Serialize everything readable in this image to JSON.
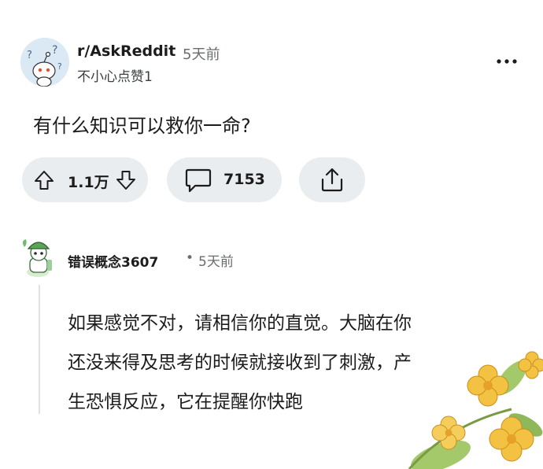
{
  "post": {
    "subreddit": "r/AskReddit",
    "time": "5天前",
    "flair": "不小心点赞1",
    "title": "有什么知识可以救你一命?"
  },
  "actions": {
    "vote_count": "1.1万",
    "comment_count": "7153"
  },
  "comment": {
    "author": "错误概念3607",
    "separator": "•",
    "time": "5天前",
    "lines": [
      "如果感觉不对，请相信你的直觉。大脑在你",
      "还没来得及思考的时候就接收到了刺激，产",
      "生恐惧反应，它在提醒你快跑"
    ]
  },
  "colors": {
    "pill_background": "#eaedef",
    "muted_text": "#6a6d70",
    "flower_yellow": "#f3c242",
    "leaf_green": "#a4c96b"
  },
  "icons": [
    "snoo-avatar-icon",
    "more-options-icon",
    "upvote-icon",
    "downvote-icon",
    "comment-icon",
    "share-icon",
    "user-avatar-icon"
  ]
}
